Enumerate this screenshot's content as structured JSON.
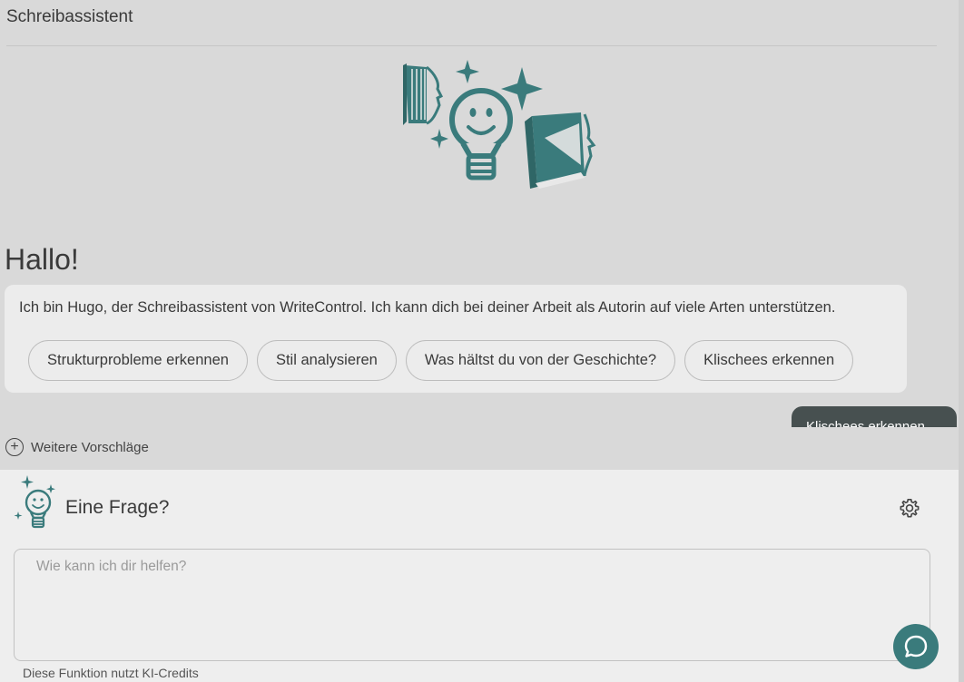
{
  "header": {
    "title": "Schreibassistent"
  },
  "assistant": {
    "greeting": "Hallo!",
    "intro": "Ich bin Hugo, der Schreibassistent von WriteControl. Ich kann dich bei deiner Arbeit als Autorin auf viele Arten unterstützen.",
    "suggestions": [
      {
        "label": "Strukturprobleme erkennen"
      },
      {
        "label": "Stil analysieren"
      },
      {
        "label": "Was hältst du von der Geschichte?"
      },
      {
        "label": "Klischees erkennen"
      }
    ]
  },
  "user_message": {
    "text": "Klischees erkennen"
  },
  "more_suggestions": {
    "label": "Weitere Vorschläge",
    "icon": "plus-circle-icon"
  },
  "question_panel": {
    "title": "Eine Frage?",
    "placeholder": "Wie kann ich dir helfen?",
    "value": "",
    "credits_note": "Diese Funktion nutzt KI-Credits",
    "settings_icon": "gear-icon",
    "chat_icon": "chat-bubble-icon"
  },
  "colors": {
    "accent": "#3a7b7c",
    "bubble": "#475050",
    "background": "#d9d9d9",
    "panel": "#eeeeee"
  }
}
